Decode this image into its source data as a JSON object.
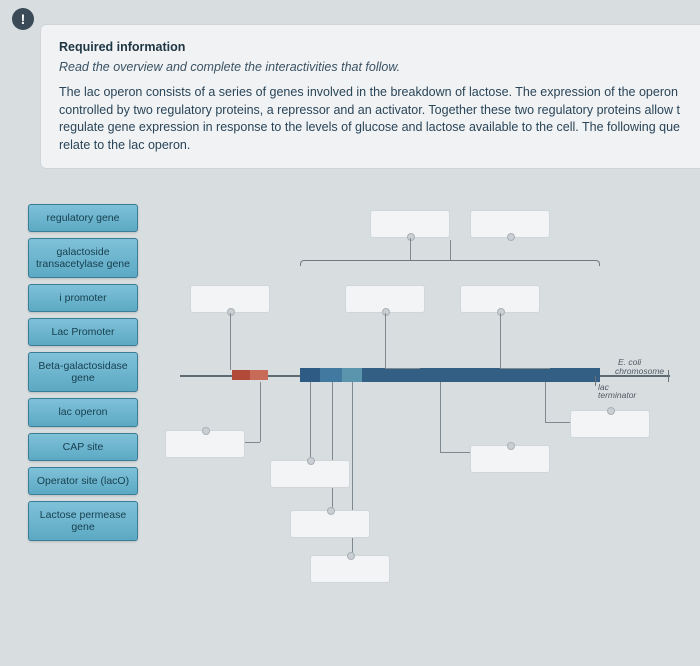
{
  "alert_glyph": "!",
  "panel": {
    "title": "Required information",
    "subtitle": "Read the overview and complete the interactivities that follow.",
    "body": "The lac operon consists of a series of genes involved in the breakdown of lactose. The expression of the operon controlled by two regulatory proteins, a repressor and an activator. Together these two regulatory proteins allow t regulate gene expression in response to the levels of glucose and lactose available to the cell. The following que relate to the lac operon."
  },
  "terms": [
    "regulatory gene",
    "galactoside transacetylase gene",
    "i promoter",
    "Lac Promoter",
    "Beta-galactosidase gene",
    "lac operon",
    "CAP site",
    "Operator site (lacO)",
    "Lactose permease gene"
  ],
  "labels": {
    "ecoli": "E. coli",
    "chromosome": "chromosome",
    "lac": "lac",
    "terminator": "terminator"
  }
}
